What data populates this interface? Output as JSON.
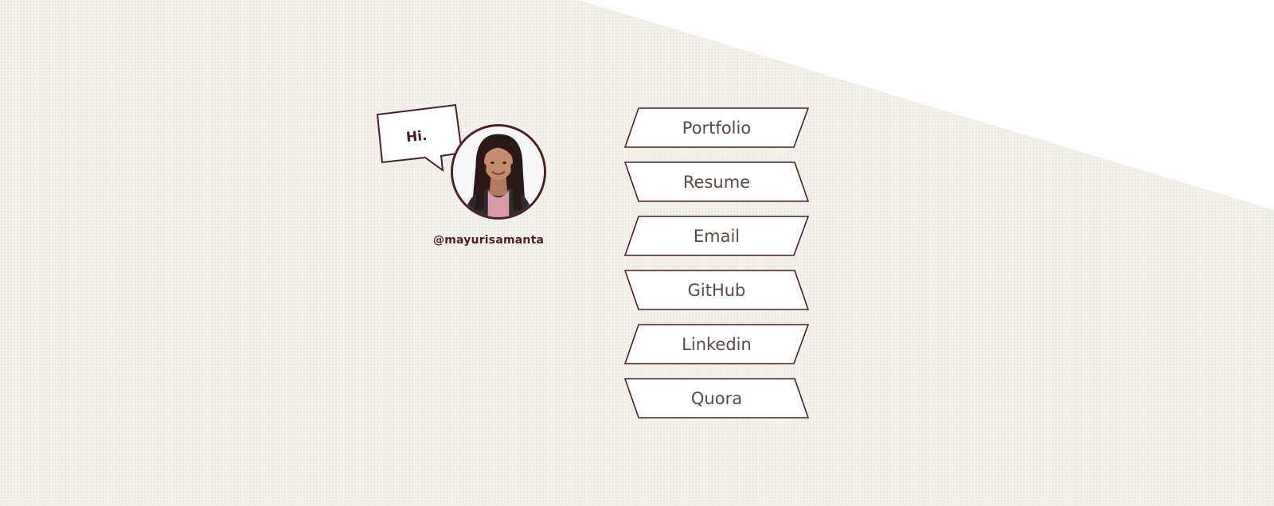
{
  "greeting": "Hi.",
  "profile": {
    "handle": "@mayurisamanta",
    "avatar_icon": "person-photo-icon"
  },
  "links": [
    {
      "label": "Portfolio"
    },
    {
      "label": "Resume"
    },
    {
      "label": "Email"
    },
    {
      "label": "GitHub"
    },
    {
      "label": "Linkedin"
    },
    {
      "label": "Quora"
    }
  ],
  "colors": {
    "background": "#f3f0ea",
    "accent_dark": "#4a1f2a",
    "button_text": "#5a4a44",
    "button_fill": "#ffffff"
  }
}
